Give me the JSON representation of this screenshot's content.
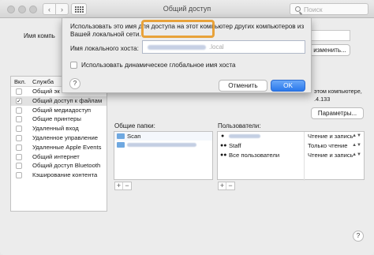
{
  "window": {
    "title": "Общий доступ",
    "search_placeholder": "Поиск",
    "nav_back": "‹",
    "nav_forward": "›"
  },
  "computer": {
    "name_label": "Имя компь",
    "edit_button": "изменить...",
    "status_line1": "этом компьютере,",
    "status_line2": ".4.133"
  },
  "services": {
    "header_on": "Вкл.",
    "header_service": "Служба",
    "items": [
      {
        "label": "Общий эк",
        "checked": false,
        "selected": false
      },
      {
        "label": "Общий доступ к файлам",
        "checked": true,
        "selected": true
      },
      {
        "label": "Общий медиадоступ",
        "checked": false,
        "selected": false
      },
      {
        "label": "Общие принтеры",
        "checked": false,
        "selected": false
      },
      {
        "label": "Удаленный вход",
        "checked": false,
        "selected": false
      },
      {
        "label": "Удаленное управление",
        "checked": false,
        "selected": false
      },
      {
        "label": "Удаленные Apple Events",
        "checked": false,
        "selected": false
      },
      {
        "label": "Общий интернет",
        "checked": false,
        "selected": false
      },
      {
        "label": "Общий доступ Bluetooth",
        "checked": false,
        "selected": false
      },
      {
        "label": "Кэширование контента",
        "checked": false,
        "selected": false
      }
    ]
  },
  "options_button": "Параметры...",
  "shared_folders": {
    "label": "Общие папки:",
    "items": [
      "Scan",
      ""
    ]
  },
  "users": {
    "label": "Пользователи:",
    "items": [
      "",
      "Staff",
      "Все пользователи"
    ],
    "permissions": [
      "Чтение и запись",
      "Только чтение",
      "Чтение и запись"
    ]
  },
  "add_symbol": "+",
  "remove_symbol": "−",
  "help_symbol": "?",
  "sheet": {
    "message": "Использовать это имя для доступа на этот компьютер других компьютеров из Вашей локальной сети.",
    "host_label": "Имя локального хоста:",
    "host_suffix": ".local",
    "dynamic_checkbox_label": "Использовать динамическое глобальное имя хоста",
    "cancel": "Отменить",
    "ok": "OK"
  }
}
